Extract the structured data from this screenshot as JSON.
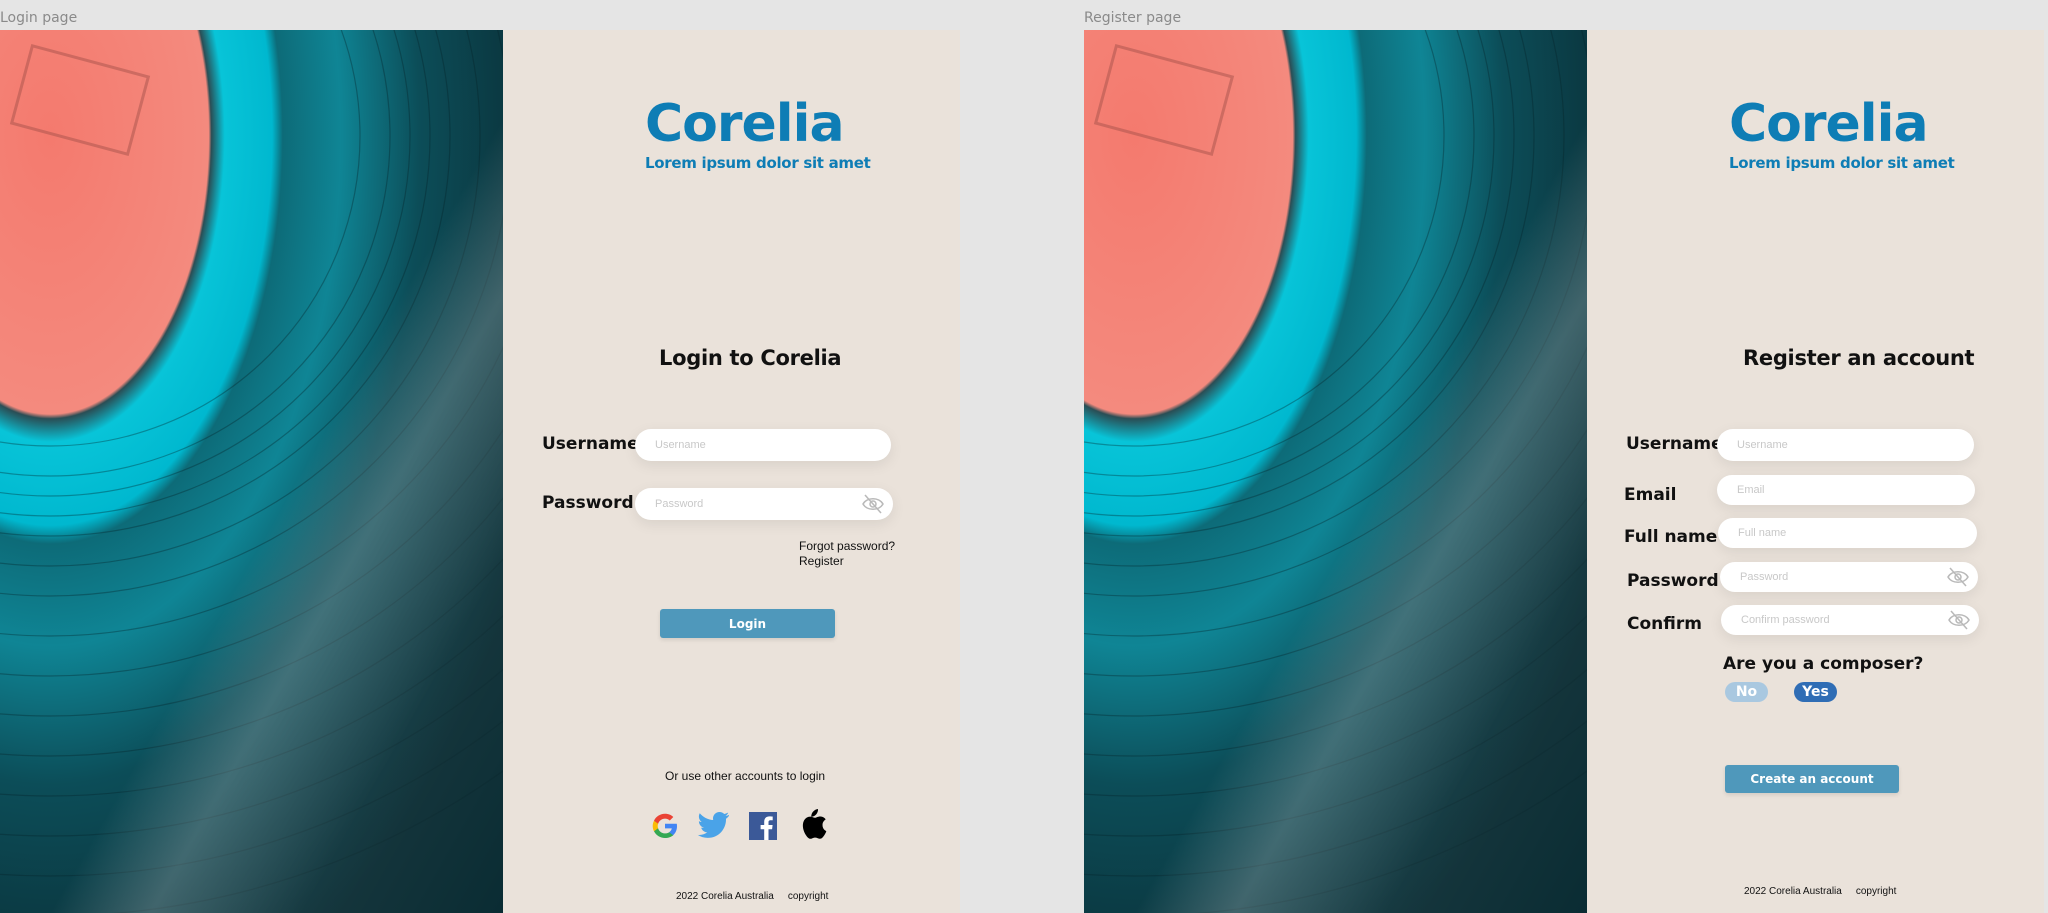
{
  "frames": {
    "login_label": "Login page",
    "register_label": "Register page"
  },
  "brand": {
    "name": "Corelia",
    "tagline": "Lorem ipsum dolor sit amet"
  },
  "colors": {
    "brand": "#0e7db5",
    "panel": "#eae2da",
    "button": "#4f98bb",
    "pill_no": "#a9c8e0",
    "pill_yes": "#2f6db5"
  },
  "login": {
    "heading": "Login to Corelia",
    "username_label": "Username",
    "username_placeholder": "Username",
    "password_label": "Password",
    "password_placeholder": "Password",
    "forgot_link": "Forgot password?",
    "register_link": "Register",
    "login_button": "Login",
    "alt_text": "Or use other accounts to login",
    "social": [
      "google-icon",
      "twitter-icon",
      "facebook-icon",
      "apple-icon"
    ],
    "footer_year": "2022 Corelia Australia",
    "footer_copy": "copyright"
  },
  "register": {
    "heading": "Register an account",
    "username_label": "Username",
    "username_placeholder": "Username",
    "email_label": "Email",
    "email_placeholder": "Email",
    "fullname_label": "Full name",
    "fullname_placeholder": "Full name",
    "password_label": "Password",
    "password_placeholder": "Password",
    "confirm_label": "Confirm",
    "confirm_placeholder": "Confirm password",
    "composer_question": "Are you a composer?",
    "no_option": "No",
    "yes_option": "Yes",
    "create_button": "Create an account",
    "footer_year": "2022 Corelia Australia",
    "footer_copy": "copyright"
  }
}
